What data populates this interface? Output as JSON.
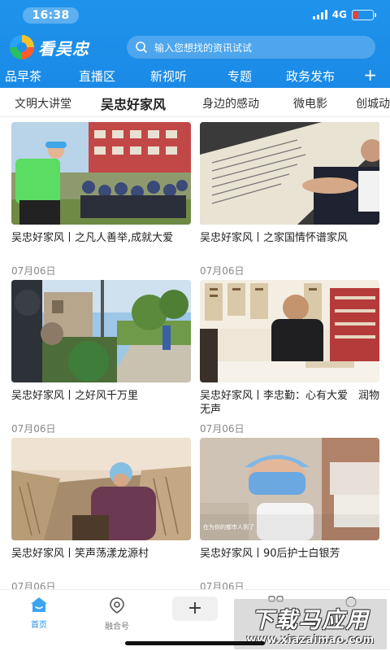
{
  "status": {
    "time": "16:38",
    "network": "4G"
  },
  "header": {
    "app_name": "看吴忠",
    "search_placeholder": "输入您想找的资讯试试"
  },
  "channels": [
    "品早茶",
    "直播区",
    "新视听",
    "专题",
    "政务发布"
  ],
  "subtabs": [
    "文明大讲堂",
    "吴忠好家风",
    "身边的感动",
    "微电影",
    "创城动"
  ],
  "active_subtab": "吴忠好家风",
  "articles": [
    {
      "title": "吴忠好家风丨之凡人善举,成就大爱",
      "date": "07月06日"
    },
    {
      "title": "吴忠好家风丨之家国情怀谱家风",
      "date": "07月06日"
    },
    {
      "title": "吴忠好家风丨之好风千万里",
      "date": "07月06日"
    },
    {
      "title": "吴忠好家风丨李忠勤：心有大爱　润物无声",
      "date": "07月06日"
    },
    {
      "title": "吴忠好家风丨笑声荡漾龙源村",
      "date": "07月06日"
    },
    {
      "title": "吴忠好家风丨90后护士白银芳",
      "date": "07月06日"
    }
  ],
  "thumb_captions": {
    "nurse_video": "在为你的都市人到了"
  },
  "bottom_nav": {
    "home": "首页",
    "merge": "融合号",
    "plus": "+"
  },
  "watermark": {
    "line1": "下载马应用",
    "line2": "www.xiazaimao.com"
  },
  "colors": {
    "brand": "#1f8fe9",
    "battery_low": "#ff3b30"
  }
}
